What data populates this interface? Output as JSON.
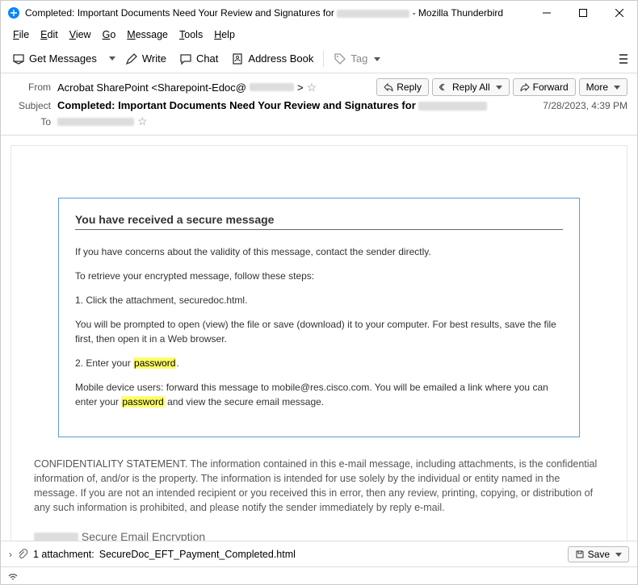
{
  "window": {
    "title_prefix": "Completed: Important Documents Need Your Review and Signatures for",
    "title_suffix": " - Mozilla Thunderbird"
  },
  "menu": {
    "file": "File",
    "edit": "Edit",
    "view": "View",
    "go": "Go",
    "message": "Message",
    "tools": "Tools",
    "help": "Help"
  },
  "toolbar": {
    "get_messages": "Get Messages",
    "write": "Write",
    "chat": "Chat",
    "address_book": "Address Book",
    "tag": "Tag"
  },
  "header": {
    "from_label": "From",
    "subject_label": "Subject",
    "to_label": "To",
    "from_value": "Acrobat SharePoint <Sharepoint-Edoc@",
    "from_close": " >",
    "subject": "Completed: Important Documents Need Your Review and Signatures for",
    "date": "7/28/2023, 4:39 PM",
    "reply": "Reply",
    "reply_all": "Reply All",
    "forward": "Forward",
    "more": "More"
  },
  "body": {
    "secure_heading": "You have received a secure message",
    "p1": "If you have concerns about the validity of this message, contact the sender directly.",
    "p2": "To retrieve your encrypted message, follow these steps:",
    "p3": "1. Click the attachment, securedoc.html.",
    "p4": "You will be prompted to open (view) the file or save (download) it to your computer. For best results, save the file first, then open it in a Web browser.",
    "step2_pre": "2. Enter your ",
    "password": "password",
    "step2_post": ".",
    "p6_pre": "Mobile device users: forward this message to mobile@res.cisco.com. You will be emailed a link where you can enter your ",
    "p6_post": "  and view the secure email message.",
    "conf": "CONFIDENTIALITY STATEMENT. The information contained in this e-mail message, including attachments, is the confidential information of, and/or is the property. The information is intended for use solely by the individual or entity named in the message. If you are not an intended recipient or you received this in error, then any review, printing, copying, or distribution of any such information is prohibited, and please notify the sender immediately by reply e-mail.",
    "enc_suffix": " Secure Email Encryption"
  },
  "attachment": {
    "count_text": "1 attachment:",
    "filename": "SecureDoc_EFT_Payment_Completed.html",
    "save": "Save"
  }
}
